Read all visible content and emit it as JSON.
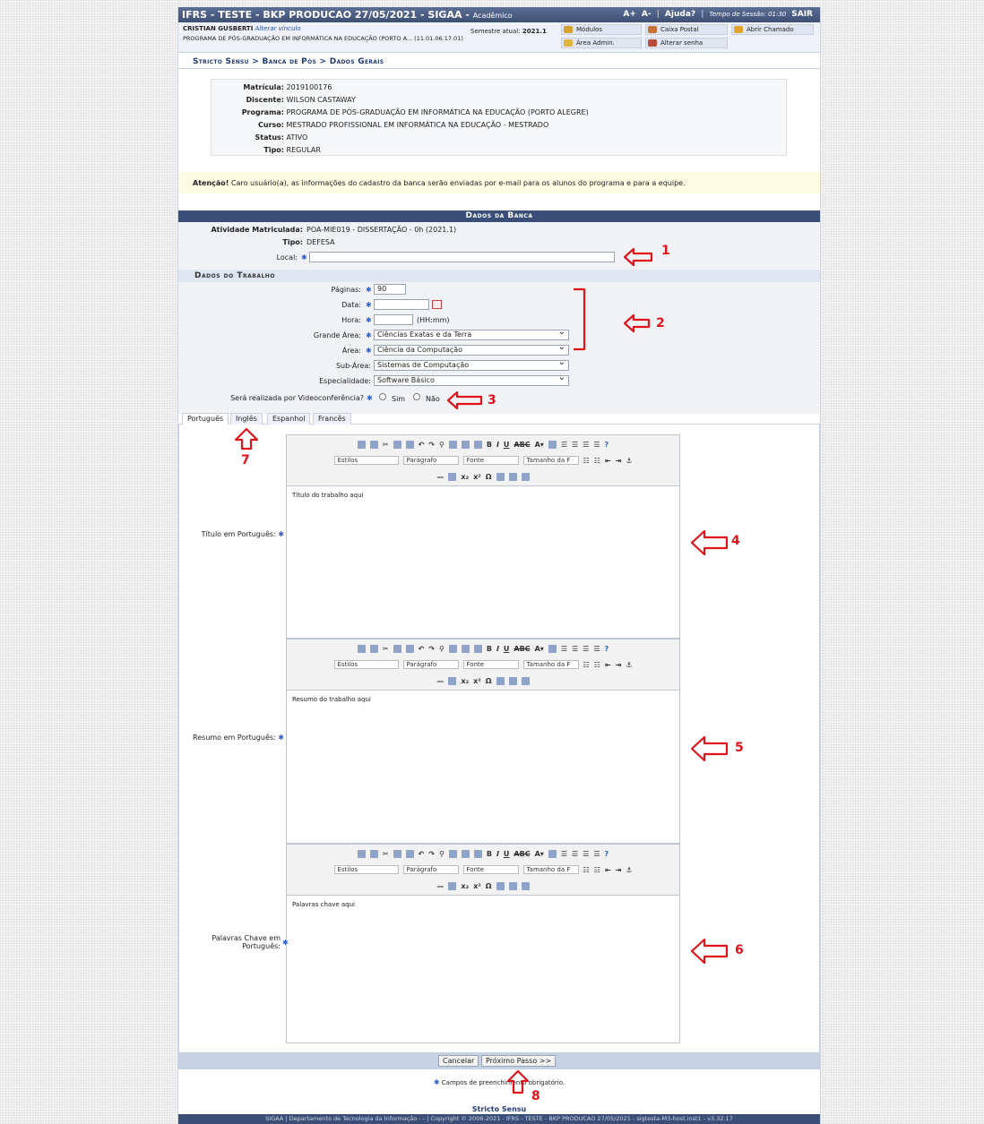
{
  "header": {
    "title": "IFRS - TESTE - BKP PRODUCAO 27/05/2021 - SIGAA -",
    "module": "Acadêmico",
    "font_up": "A+",
    "font_down": "A-",
    "help": "Ajuda?",
    "session": "Tempo de Sessão: 01:30",
    "logout": "SAIR"
  },
  "user": {
    "name": "CRISTIAN GUSBERTI",
    "change_link": "Alterar vínculo",
    "program_line": "PROGRAMA DE PÓS-GRADUAÇÃO EM INFORMÁTICA NA EDUCAÇÃO (PORTO A... (11.01.06.17.01)",
    "semester_label": "Semestre atual:",
    "semester": "2021.1"
  },
  "menu": {
    "modulos": "Módulos",
    "caixa_postal": "Caixa Postal",
    "abrir_chamado": "Abrir Chamado",
    "area_admin": "Área Admin.",
    "alterar_senha": "Alterar senha"
  },
  "breadcrumb": "Stricto Sensu > Banca de Pós > Dados Gerais",
  "student": [
    {
      "label": "Matrícula:",
      "value": "2019100176"
    },
    {
      "label": "Discente:",
      "value": "WILSON CASTAWAY"
    },
    {
      "label": "Programa:",
      "value": "PROGRAMA DE PÓS-GRADUAÇÃO EM INFORMÁTICA NA EDUCAÇÃO (PORTO ALEGRE)"
    },
    {
      "label": "Curso:",
      "value": "MESTRADO PROFISSIONAL EM INFORMÁTICA NA EDUCAÇÃO - MESTRADO"
    },
    {
      "label": "Status:",
      "value": "ATIVO"
    },
    {
      "label": "Tipo:",
      "value": "REGULAR"
    }
  ],
  "notice": {
    "bold": "Atenção!",
    "text": " Caro usuário(a), as informações do cadastro da banca serão enviadas por e-mail para os alunos do programa e para a equipe."
  },
  "banca": {
    "header": "Dados da Banca",
    "atividade_label": "Atividade Matriculada:",
    "atividade": "POA-MIE019 - DISSERTAÇÃO - 0h (2021.1)",
    "tipo_label": "Tipo:",
    "tipo": "DEFESA",
    "local_label": "Local:",
    "local_value": ""
  },
  "trabalho": {
    "header": "Dados do Trabalho",
    "paginas_label": "Páginas:",
    "paginas": "90",
    "data_label": "Data:",
    "data": "",
    "hora_label": "Hora:",
    "hora": "",
    "hora_hint": "(HH:mm)",
    "grande_area_label": "Grande Área:",
    "grande_area": "Ciências Exatas e da Terra",
    "area_label": "Área:",
    "area": "Ciência da Computação",
    "subarea_label": "Sub-Área:",
    "subarea": "Sistemas de Computação",
    "especialidade_label": "Especialidade:",
    "especialidade": "Software Básico",
    "video_label": "Será realizada por Videoconferência?",
    "sim": "Sim",
    "nao": "Não"
  },
  "tabs": [
    "Português",
    "Inglês",
    "Espanhol",
    "Francês"
  ],
  "toolbar": {
    "estilos": "Estilos",
    "paragrafo": "Parágrafo",
    "fonte": "Fonte",
    "tamanho": "Tamanho da F"
  },
  "editors": [
    {
      "label": "Título em Português:",
      "content": "Título do trabalho aqui"
    },
    {
      "label": "Resumo em Português:",
      "content": "Resumo do trabalho aqui"
    },
    {
      "label": "Palavras Chave em Português:",
      "content": "Palavras chave aqui"
    }
  ],
  "buttons": {
    "cancel": "Cancelar",
    "next": "Próximo Passo >>"
  },
  "required_note": "Campos de preenchimento obrigatório.",
  "footer_link": "Stricto Sensu",
  "footer": "SIGAA | Departamento de Tecnologia da Informação - - | Copyright © 2006-2021 - IFRS - TESTE - BKP PRODUCAO 27/05/2021 - sigtesta-M3-host.inst1 - v3.32.17",
  "annotations": [
    "1",
    "2",
    "3",
    "4",
    "5",
    "6",
    "7",
    "8"
  ],
  "colors": {
    "annotation": "#e0141a",
    "header": "#3a4e78",
    "required": "#2b5fd6"
  }
}
